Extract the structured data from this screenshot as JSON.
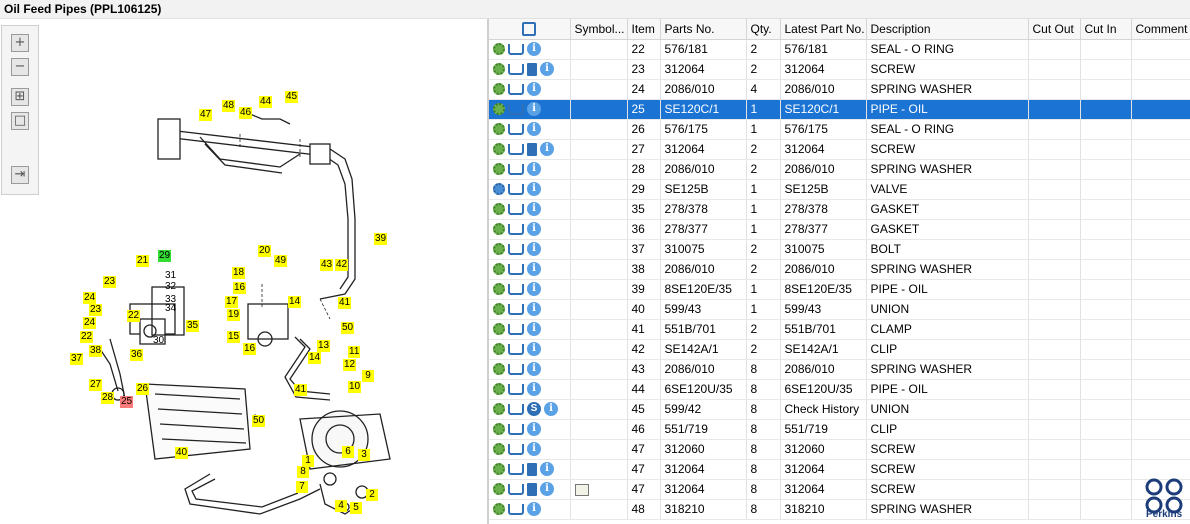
{
  "window": {
    "title": "Oil Feed Pipes (PPL106125)"
  },
  "toolbar": {
    "buttons": [
      {
        "name": "zoom-in-icon",
        "glyph": "+"
      },
      {
        "name": "zoom-out-icon",
        "glyph": "−"
      },
      {
        "name": "fit-all-icon",
        "glyph": "⊞"
      },
      {
        "name": "fit-page-icon",
        "glyph": "□"
      },
      {
        "name": "export-list-icon",
        "glyph": "⇥"
      }
    ]
  },
  "diagram": {
    "callouts": [
      {
        "label": "48"
      },
      {
        "label": "44"
      },
      {
        "label": "45"
      },
      {
        "label": "47"
      },
      {
        "label": "46"
      },
      {
        "label": "39"
      },
      {
        "label": "20"
      },
      {
        "label": "49"
      },
      {
        "label": "29",
        "style": "green"
      },
      {
        "label": "21"
      },
      {
        "label": "18"
      },
      {
        "label": "43"
      },
      {
        "label": "42"
      },
      {
        "label": "23"
      },
      {
        "label": "24"
      },
      {
        "label": "16"
      },
      {
        "label": "17"
      },
      {
        "label": "14"
      },
      {
        "label": "41"
      },
      {
        "label": "23"
      },
      {
        "label": "22"
      },
      {
        "label": "19"
      },
      {
        "label": "35"
      },
      {
        "label": "24"
      },
      {
        "label": "50"
      },
      {
        "label": "22"
      },
      {
        "label": "15"
      },
      {
        "label": "16"
      },
      {
        "label": "13"
      },
      {
        "label": "11"
      },
      {
        "label": "38"
      },
      {
        "label": "36"
      },
      {
        "label": "14"
      },
      {
        "label": "37"
      },
      {
        "label": "12"
      },
      {
        "label": "26"
      },
      {
        "label": "27"
      },
      {
        "label": "9"
      },
      {
        "label": "10"
      },
      {
        "label": "28"
      },
      {
        "label": "25",
        "style": "red"
      },
      {
        "label": "41"
      },
      {
        "label": "50"
      },
      {
        "label": "40"
      },
      {
        "label": "6"
      },
      {
        "label": "3"
      },
      {
        "label": "1"
      },
      {
        "label": "8"
      },
      {
        "label": "7"
      },
      {
        "label": "2"
      },
      {
        "label": "4"
      },
      {
        "label": "5"
      }
    ],
    "plain_labels": [
      {
        "label": "31"
      },
      {
        "label": "32"
      },
      {
        "label": "33"
      },
      {
        "label": "34"
      },
      {
        "label": "30"
      }
    ]
  },
  "grid": {
    "columns": [
      "",
      "Symbol...",
      "Item",
      "Parts No.",
      "Qty.",
      "Latest Part No.",
      "Description",
      "Cut Out",
      "Cut In",
      "Comment"
    ],
    "rows": [
      {
        "icons": [
          "gear",
          "cart",
          "info"
        ],
        "symbol": "",
        "item": "22",
        "part": "576/181",
        "qty": "2",
        "latest": "576/181",
        "desc": "SEAL - O RING"
      },
      {
        "icons": [
          "gear",
          "cart",
          "book",
          "info"
        ],
        "symbol": "",
        "item": "23",
        "part": "312064",
        "qty": "2",
        "latest": "312064",
        "desc": "SCREW"
      },
      {
        "icons": [
          "gear",
          "cart",
          "info"
        ],
        "symbol": "",
        "item": "24",
        "part": "2086/010",
        "qty": "4",
        "latest": "2086/010",
        "desc": "SPRING WASHER"
      },
      {
        "icons": [
          "gear",
          "cart",
          "info"
        ],
        "symbol": "",
        "item": "25",
        "part": "SE120C/1",
        "qty": "1",
        "latest": "SE120C/1",
        "desc": "PIPE - OIL",
        "selected": true
      },
      {
        "icons": [
          "gear",
          "cart",
          "info"
        ],
        "symbol": "",
        "item": "26",
        "part": "576/175",
        "qty": "1",
        "latest": "576/175",
        "desc": "SEAL - O RING"
      },
      {
        "icons": [
          "gear",
          "cart",
          "book",
          "info"
        ],
        "symbol": "",
        "item": "27",
        "part": "312064",
        "qty": "2",
        "latest": "312064",
        "desc": "SCREW"
      },
      {
        "icons": [
          "gear",
          "cart",
          "info"
        ],
        "symbol": "",
        "item": "28",
        "part": "2086/010",
        "qty": "2",
        "latest": "2086/010",
        "desc": "SPRING WASHER"
      },
      {
        "icons": [
          "gear-blue",
          "cart",
          "info"
        ],
        "symbol": "",
        "item": "29",
        "part": "SE125B",
        "qty": "1",
        "latest": "SE125B",
        "desc": "VALVE"
      },
      {
        "icons": [
          "gear",
          "cart",
          "info"
        ],
        "symbol": "",
        "item": "35",
        "part": "278/378",
        "qty": "1",
        "latest": "278/378",
        "desc": "GASKET"
      },
      {
        "icons": [
          "gear",
          "cart",
          "info"
        ],
        "symbol": "",
        "item": "36",
        "part": "278/377",
        "qty": "1",
        "latest": "278/377",
        "desc": "GASKET"
      },
      {
        "icons": [
          "gear",
          "cart",
          "info"
        ],
        "symbol": "",
        "item": "37",
        "part": "310075",
        "qty": "2",
        "latest": "310075",
        "desc": "BOLT"
      },
      {
        "icons": [
          "gear",
          "cart",
          "info"
        ],
        "symbol": "",
        "item": "38",
        "part": "2086/010",
        "qty": "2",
        "latest": "2086/010",
        "desc": "SPRING WASHER"
      },
      {
        "icons": [
          "gear",
          "cart",
          "info"
        ],
        "symbol": "",
        "item": "39",
        "part": "8SE120E/35",
        "qty": "1",
        "latest": "8SE120E/35",
        "desc": "PIPE - OIL"
      },
      {
        "icons": [
          "gear",
          "cart",
          "info"
        ],
        "symbol": "",
        "item": "40",
        "part": "599/43",
        "qty": "1",
        "latest": "599/43",
        "desc": "UNION"
      },
      {
        "icons": [
          "gear",
          "cart",
          "info"
        ],
        "symbol": "",
        "item": "41",
        "part": "551B/701",
        "qty": "2",
        "latest": "551B/701",
        "desc": "CLAMP"
      },
      {
        "icons": [
          "gear",
          "cart",
          "info"
        ],
        "symbol": "",
        "item": "42",
        "part": "SE142A/1",
        "qty": "2",
        "latest": "SE142A/1",
        "desc": "CLIP"
      },
      {
        "icons": [
          "gear",
          "cart",
          "info"
        ],
        "symbol": "",
        "item": "43",
        "part": "2086/010",
        "qty": "8",
        "latest": "2086/010",
        "desc": "SPRING WASHER"
      },
      {
        "icons": [
          "gear",
          "cart",
          "info"
        ],
        "symbol": "",
        "item": "44",
        "part": "6SE120U/35",
        "qty": "8",
        "latest": "6SE120U/35",
        "desc": "PIPE - OIL"
      },
      {
        "icons": [
          "gear",
          "cart",
          "s",
          "info"
        ],
        "symbol": "",
        "item": "45",
        "part": "599/42",
        "qty": "8",
        "latest": "Check History",
        "desc": "UNION"
      },
      {
        "icons": [
          "gear",
          "cart",
          "info"
        ],
        "symbol": "",
        "item": "46",
        "part": "551/719",
        "qty": "8",
        "latest": "551/719",
        "desc": "CLIP"
      },
      {
        "icons": [
          "gear",
          "cart",
          "info"
        ],
        "symbol": "",
        "item": "47",
        "part": "312060",
        "qty": "8",
        "latest": "312060",
        "desc": "SCREW"
      },
      {
        "icons": [
          "gear",
          "cart",
          "book",
          "info"
        ],
        "symbol": "",
        "item": "47",
        "part": "312064",
        "qty": "8",
        "latest": "312064",
        "desc": "SCREW"
      },
      {
        "icons": [
          "gear",
          "cart",
          "book",
          "info"
        ],
        "symbol": "map",
        "item": "47",
        "part": "312064",
        "qty": "8",
        "latest": "312064",
        "desc": "SCREW"
      },
      {
        "icons": [
          "gear",
          "cart",
          "info"
        ],
        "symbol": "",
        "item": "48",
        "part": "318210",
        "qty": "8",
        "latest": "318210",
        "desc": "SPRING WASHER"
      }
    ]
  },
  "brand": {
    "name": "Perkins"
  },
  "colors": {
    "selected_row": "#1b73d3",
    "callout": "#ffff00",
    "callout_green": "#33dd33",
    "callout_red": "#ff7b7b"
  }
}
